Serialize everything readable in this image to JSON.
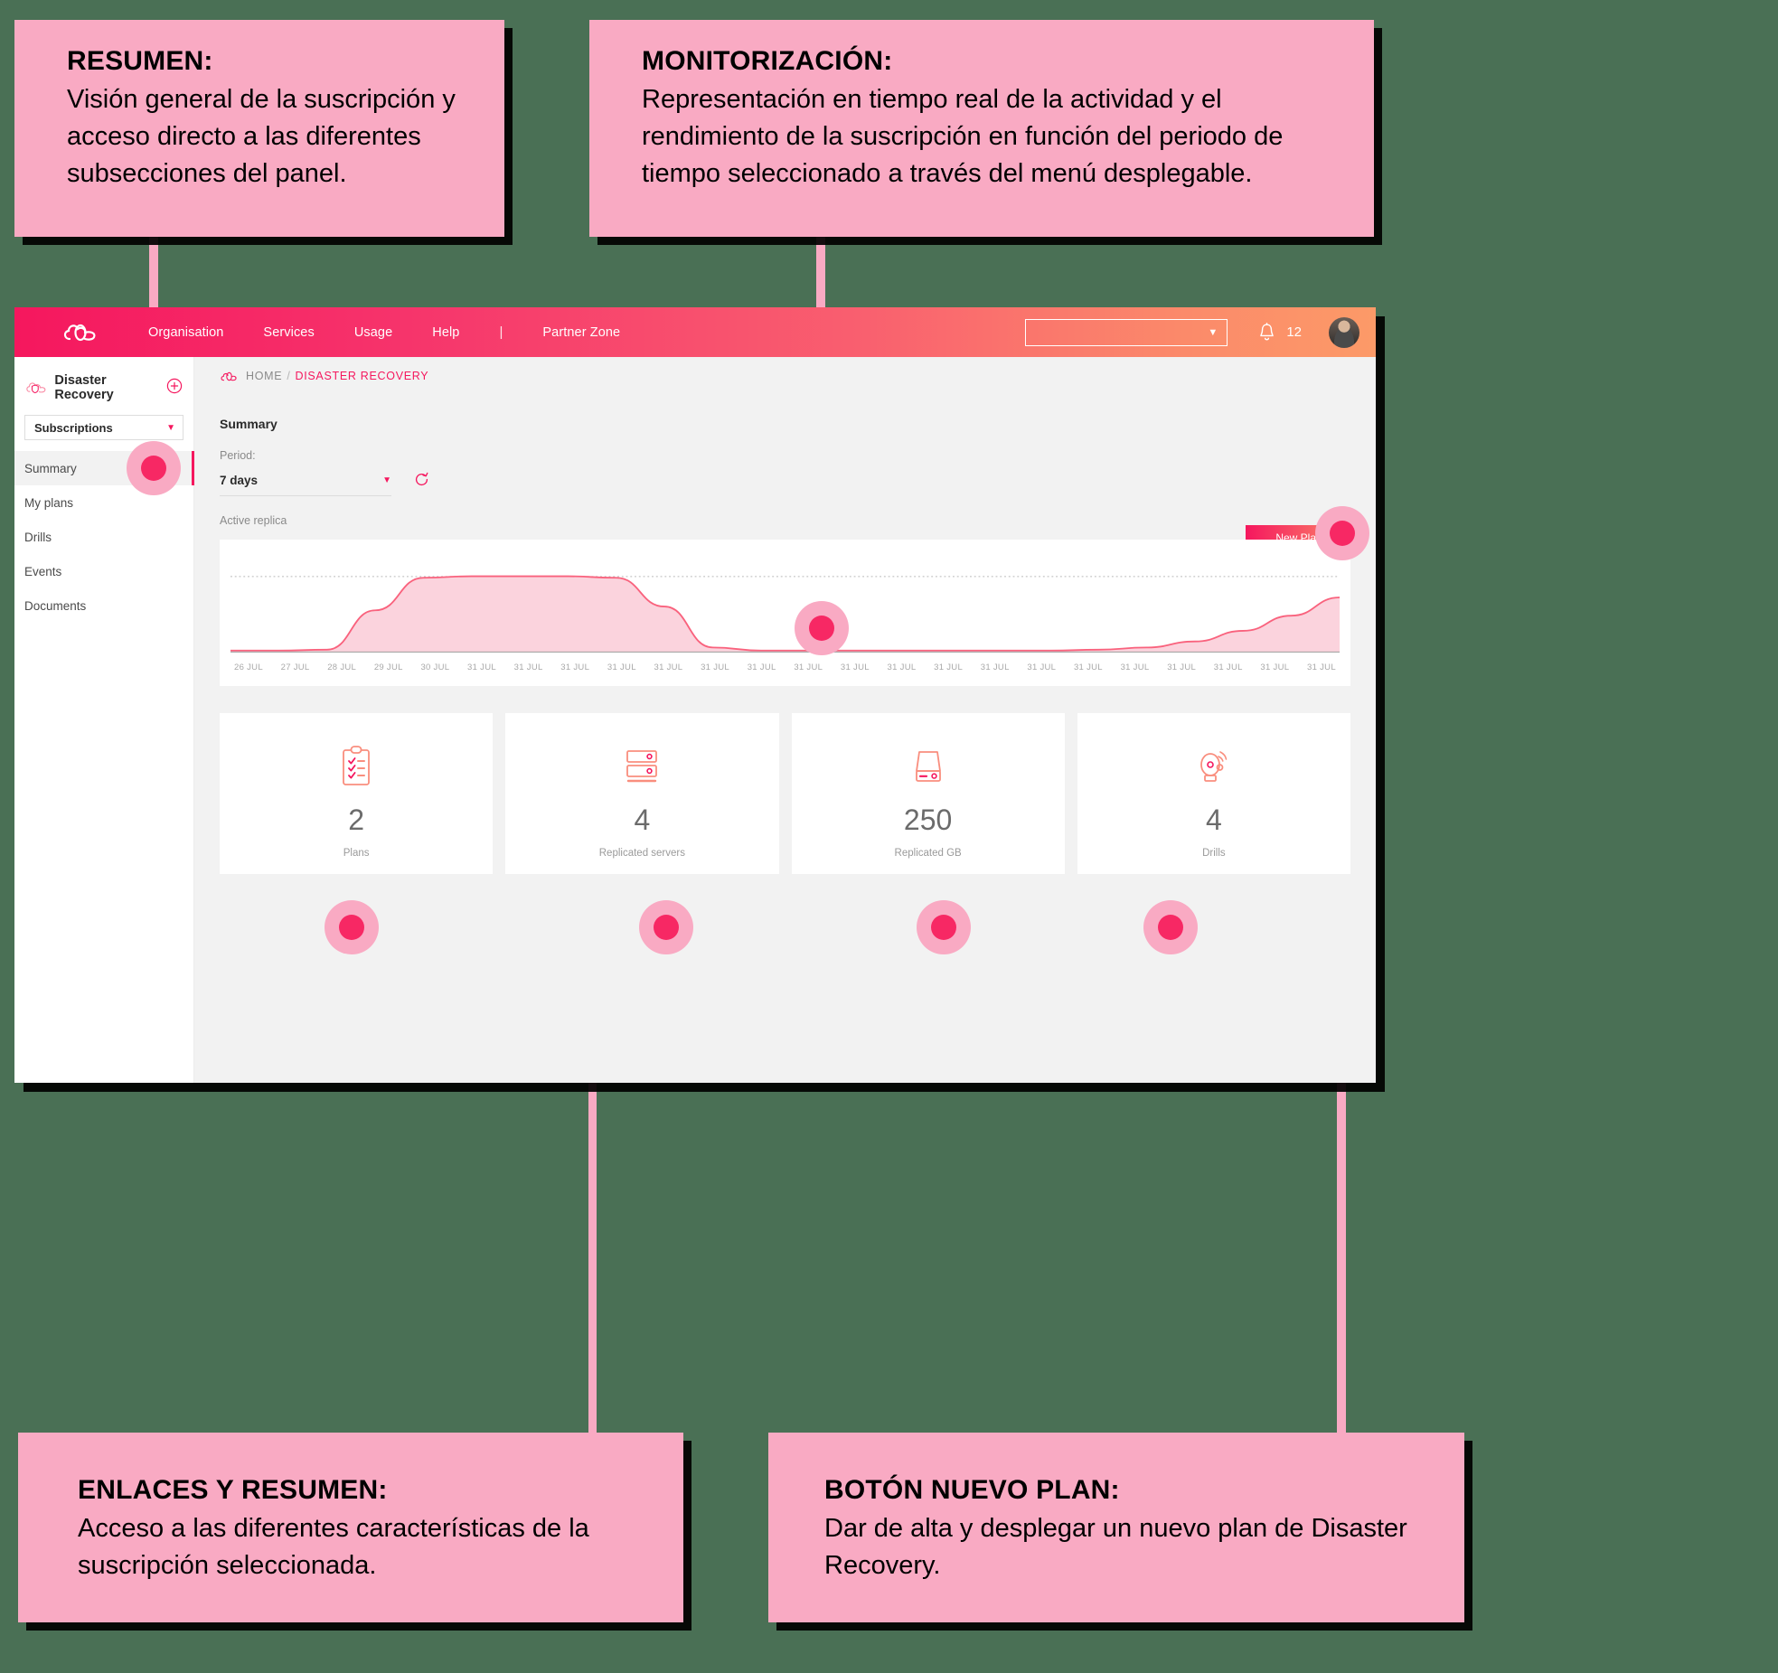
{
  "callouts": [
    {
      "id": "resumen",
      "title": "RESUMEN:",
      "body": "Visión general de la suscripción y acceso directo a las diferentes subsecciones del panel."
    },
    {
      "id": "monitorizacion",
      "title": "MONITORIZACIÓN:",
      "body": "Representación en tiempo real de la actividad y el rendimiento de la suscripción en función del periodo de tiempo seleccionado a través del menú desplegable."
    },
    {
      "id": "enlaces",
      "title": "ENLACES Y RESUMEN:",
      "body": "Acceso a las diferentes características de la suscripción seleccionada."
    },
    {
      "id": "boton",
      "title": "BOTÓN NUEVO PLAN:",
      "body": "Dar de alta y desplegar un nuevo plan de Disaster Recovery."
    }
  ],
  "navbar": {
    "logo_icon": "cloud-logo-icon",
    "links": [
      "Organisation",
      "Services",
      "Usage",
      "Help"
    ],
    "separator": "|",
    "partner_link": "Partner Zone",
    "select_value": "",
    "select_caret_icon": "chevron-down-icon",
    "bell_icon": "bell-icon",
    "notification_count": "12",
    "avatar_name": "user-avatar"
  },
  "sidebar": {
    "icon": "cloud-shield-icon",
    "title": "Disaster Recovery",
    "add_icon": "plus-circle-icon",
    "selector_value": "Subscriptions",
    "selector_caret_icon": "chevron-down-icon",
    "items": [
      {
        "label": "Summary",
        "active": true
      },
      {
        "label": "My plans",
        "active": false
      },
      {
        "label": "Drills",
        "active": false
      },
      {
        "label": "Events",
        "active": false
      },
      {
        "label": "Documents",
        "active": false
      }
    ]
  },
  "main": {
    "breadcrumb": {
      "icon": "cloud-icon",
      "home": "HOME",
      "separator": "/",
      "current": "DISASTER RECOVERY"
    },
    "section_title": "Summary",
    "period_label": "Period:",
    "period_value": "7 days",
    "period_caret_icon": "chevron-down-icon",
    "refresh_icon": "refresh-icon",
    "new_plan_button": "New Plan",
    "chart_label": "Active replica",
    "stat_cards": [
      {
        "icon": "clipboard-checklist-icon",
        "value": "2",
        "label": "Plans"
      },
      {
        "icon": "server-rack-icon",
        "value": "4",
        "label": "Replicated servers"
      },
      {
        "icon": "hard-drive-icon",
        "value": "250",
        "label": "Replicated GB"
      },
      {
        "icon": "alarm-bell-icon",
        "value": "4",
        "label": "Drills"
      }
    ]
  },
  "chart_data": {
    "type": "area",
    "title": "Active replica",
    "xlabel": "",
    "ylabel": "",
    "grid": true,
    "legend": "none",
    "categories": [
      "26 JUL",
      "27 JUL",
      "28 JUL",
      "29 JUL",
      "30 JUL",
      "31 JUL",
      "31 JUL",
      "31 JUL",
      "31 JUL",
      "31 JUL",
      "31 JUL",
      "31 JUL",
      "31 JUL",
      "31 JUL",
      "31 JUL",
      "31 JUL",
      "31 JUL",
      "31 JUL",
      "31 JUL",
      "31 JUL",
      "31 JUL",
      "31 JUL",
      "31 JUL",
      "31 JUL"
    ],
    "values": [
      2,
      2,
      3,
      55,
      98,
      100,
      100,
      100,
      98,
      60,
      6,
      2,
      2,
      2,
      2,
      2,
      2,
      2,
      3,
      6,
      14,
      28,
      48,
      72
    ],
    "ylim": [
      0,
      130
    ],
    "series": [
      {
        "name": "Active replica",
        "values": [
          2,
          2,
          3,
          55,
          98,
          100,
          100,
          100,
          98,
          60,
          6,
          2,
          2,
          2,
          2,
          2,
          2,
          2,
          3,
          6,
          14,
          28,
          48,
          72
        ]
      }
    ],
    "reference_line": 100,
    "colors": {
      "line": "#f9627d",
      "fill": "#fbd3dd",
      "grid": "#c9c9c9"
    }
  },
  "colors": {
    "accent": "#f5175e",
    "accent_light": "#f9aac3",
    "dot": "#f72864",
    "background": "#4a7055",
    "panel": "#f2f2f2"
  }
}
